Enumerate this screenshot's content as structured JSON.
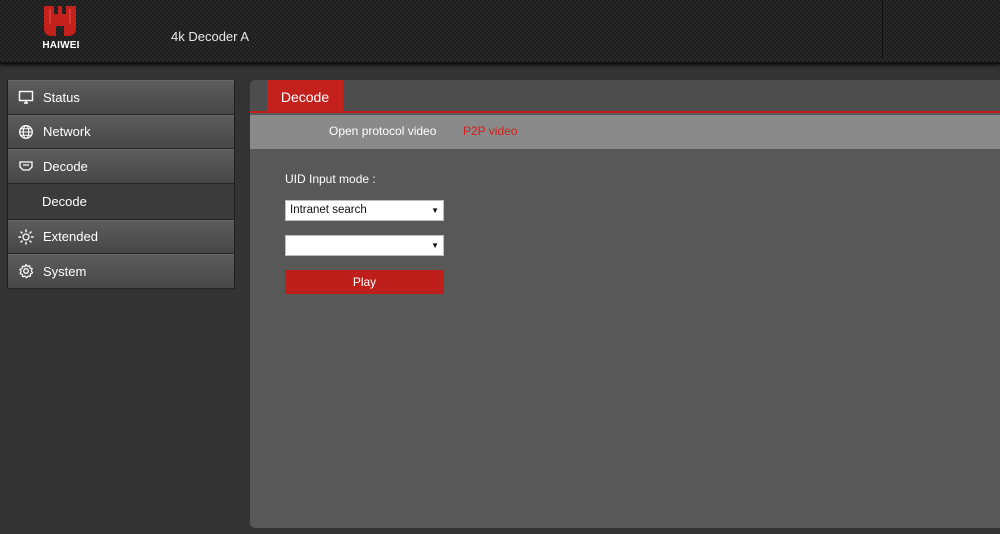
{
  "header": {
    "brand": "HAIWEI",
    "device_title": "4k Decoder  A",
    "brand_color": "#c4201c"
  },
  "sidebar": {
    "items": [
      {
        "label": "Status",
        "icon": "monitor-icon"
      },
      {
        "label": "Network",
        "icon": "globe-icon"
      },
      {
        "label": "Decode",
        "icon": "decoder-icon"
      },
      {
        "label": "Decode",
        "sub": true
      },
      {
        "label": "Extended",
        "icon": "sun-gear-icon"
      },
      {
        "label": "System",
        "icon": "gear-icon"
      }
    ]
  },
  "main": {
    "active_tab": "Decode",
    "subtabs": [
      "Open protocol video",
      "P2P video"
    ],
    "active_subtab": "P2P video",
    "uid_label": "UID Input mode :",
    "mode_select_value": "Intranet search",
    "device_select_value": "",
    "play_label": "Play"
  }
}
